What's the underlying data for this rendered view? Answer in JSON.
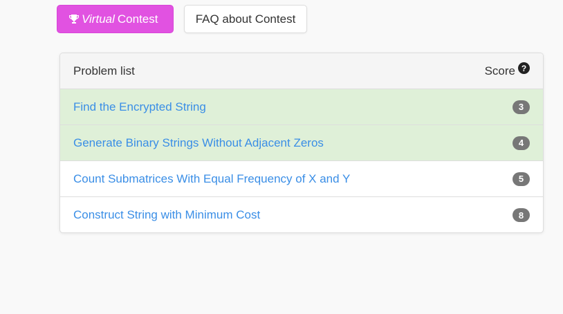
{
  "toolbar": {
    "virtual_italic": "Virtual",
    "virtual_rest": "Contest",
    "faq_label": "FAQ about Contest"
  },
  "panel": {
    "header_label": "Problem list",
    "score_label": "Score",
    "help_glyph": "?"
  },
  "problems": [
    {
      "title": "Find the Encrypted String",
      "score": "3",
      "solved": true
    },
    {
      "title": "Generate Binary Strings Without Adjacent Zeros",
      "score": "4",
      "solved": true
    },
    {
      "title": "Count Submatrices With Equal Frequency of X and Y",
      "score": "5",
      "solved": false
    },
    {
      "title": "Construct String with Minimum Cost",
      "score": "8",
      "solved": false
    }
  ],
  "colors": {
    "accent": "#e152e1",
    "link": "#3a8ee6",
    "solved_row": "#dff0d8",
    "badge": "#777777"
  },
  "icons": {
    "virtual_button": "trophy-icon",
    "score_help": "question-circle-icon"
  }
}
